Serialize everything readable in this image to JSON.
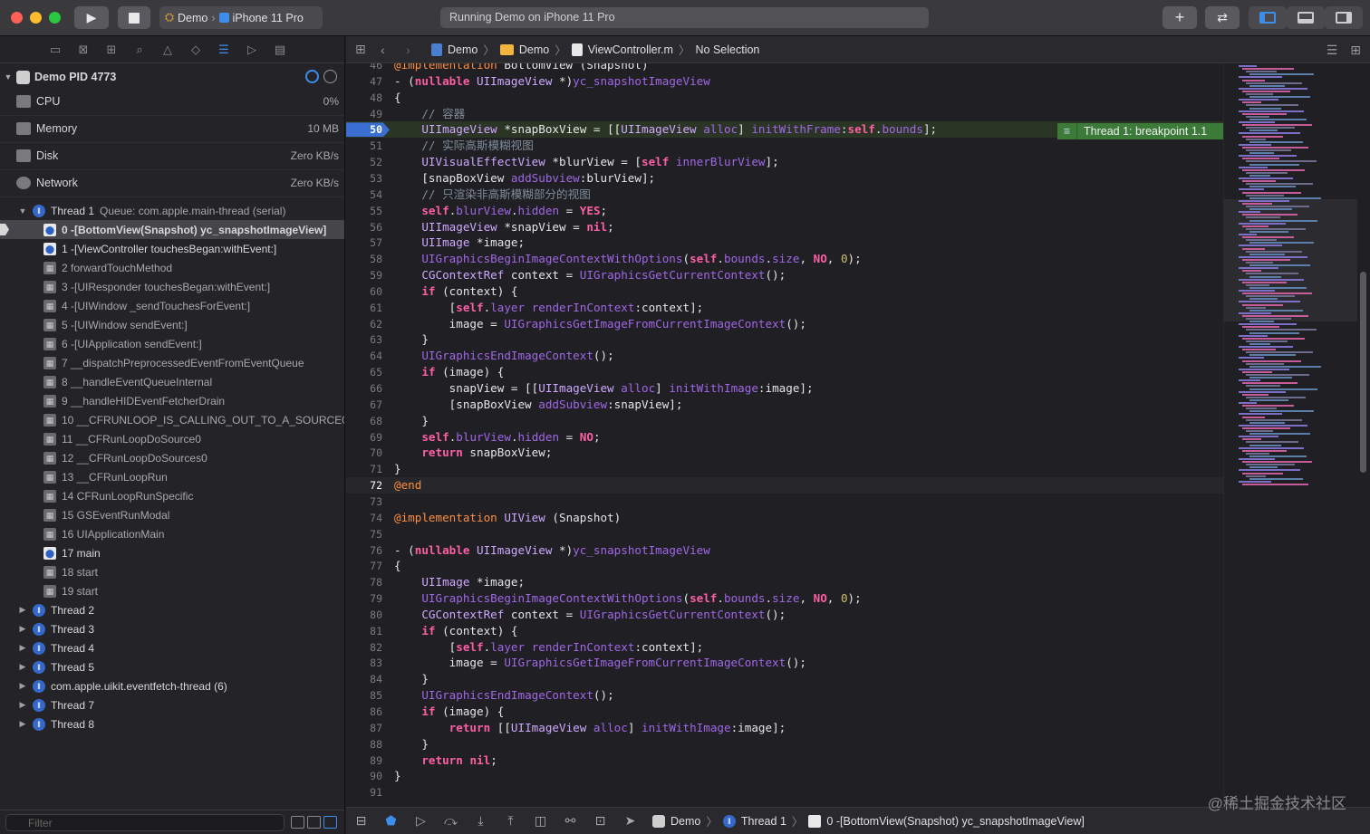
{
  "toolbar": {
    "scheme_target": "Demo",
    "scheme_device": "iPhone 11 Pro",
    "activity_status": "Running Demo on iPhone 11 Pro",
    "run_icon": "play-icon",
    "stop_icon": "stop-icon"
  },
  "navigator": {
    "process": "Demo PID 4773",
    "gauges": [
      {
        "label": "CPU",
        "value": "0%"
      },
      {
        "label": "Memory",
        "value": "10 MB"
      },
      {
        "label": "Disk",
        "value": "Zero KB/s"
      },
      {
        "label": "Network",
        "value": "Zero KB/s"
      }
    ],
    "thread1": "Thread 1",
    "thread1_queue": "Queue: com.apple.main-thread (serial)",
    "frames": [
      {
        "label": "0 -[BottomView(Snapshot) yc_snapshotImageView]",
        "kind": "user",
        "selected": true
      },
      {
        "label": "1 -[ViewController touchesBegan:withEvent:]",
        "kind": "user"
      },
      {
        "label": "2 forwardTouchMethod",
        "kind": "sys"
      },
      {
        "label": "3 -[UIResponder touchesBegan:withEvent:]",
        "kind": "sys"
      },
      {
        "label": "4 -[UIWindow _sendTouchesForEvent:]",
        "kind": "sys"
      },
      {
        "label": "5 -[UIWindow sendEvent:]",
        "kind": "sys"
      },
      {
        "label": "6 -[UIApplication sendEvent:]",
        "kind": "sys"
      },
      {
        "label": "7 __dispatchPreprocessedEventFromEventQueue",
        "kind": "sys"
      },
      {
        "label": "8 __handleEventQueueInternal",
        "kind": "sys"
      },
      {
        "label": "9 __handleHIDEventFetcherDrain",
        "kind": "sys"
      },
      {
        "label": "10 __CFRUNLOOP_IS_CALLING_OUT_TO_A_SOURCE0_...",
        "kind": "sys"
      },
      {
        "label": "11 __CFRunLoopDoSource0",
        "kind": "sys"
      },
      {
        "label": "12 __CFRunLoopDoSources0",
        "kind": "sys"
      },
      {
        "label": "13 __CFRunLoopRun",
        "kind": "sys"
      },
      {
        "label": "14 CFRunLoopRunSpecific",
        "kind": "sys"
      },
      {
        "label": "15 GSEventRunModal",
        "kind": "sys"
      },
      {
        "label": "16 UIApplicationMain",
        "kind": "sys"
      },
      {
        "label": "17 main",
        "kind": "user"
      },
      {
        "label": "18 start",
        "kind": "sys"
      },
      {
        "label": "19 start",
        "kind": "sys"
      }
    ],
    "other_threads": [
      "Thread 2",
      "Thread 3",
      "Thread 4",
      "Thread 5",
      "com.apple.uikit.eventfetch-thread (6)",
      "Thread 7",
      "Thread 8"
    ],
    "filter_placeholder": "Filter"
  },
  "jumpbar": {
    "crumbs": [
      "Demo",
      "Demo",
      "ViewController.m",
      "No Selection"
    ]
  },
  "editor": {
    "breakpoint_line": 50,
    "current_line": 72,
    "breakpoint_label": "Thread 1: breakpoint 1.1",
    "lines": [
      {
        "n": 46,
        "t": "@implementation BottomView (Snapshot)"
      },
      {
        "n": 47,
        "t": "- (nullable UIImageView *)yc_snapshotImageView"
      },
      {
        "n": 48,
        "t": "{"
      },
      {
        "n": 49,
        "t": "    // 容器"
      },
      {
        "n": 50,
        "t": "    UIImageView *snapBoxView = [[UIImageView alloc] initWithFrame:self.bounds];"
      },
      {
        "n": 51,
        "t": "    // 实际高斯模糊视图"
      },
      {
        "n": 52,
        "t": "    UIVisualEffectView *blurView = [self innerBlurView];"
      },
      {
        "n": 53,
        "t": "    [snapBoxView addSubview:blurView];"
      },
      {
        "n": 54,
        "t": "    // 只渲染非高斯模糊部分的视图"
      },
      {
        "n": 55,
        "t": "    self.blurView.hidden = YES;"
      },
      {
        "n": 56,
        "t": "    UIImageView *snapView = nil;"
      },
      {
        "n": 57,
        "t": "    UIImage *image;"
      },
      {
        "n": 58,
        "t": "    UIGraphicsBeginImageContextWithOptions(self.bounds.size, NO, 0);"
      },
      {
        "n": 59,
        "t": "    CGContextRef context = UIGraphicsGetCurrentContext();"
      },
      {
        "n": 60,
        "t": "    if (context) {"
      },
      {
        "n": 61,
        "t": "        [self.layer renderInContext:context];"
      },
      {
        "n": 62,
        "t": "        image = UIGraphicsGetImageFromCurrentImageContext();"
      },
      {
        "n": 63,
        "t": "    }"
      },
      {
        "n": 64,
        "t": "    UIGraphicsEndImageContext();"
      },
      {
        "n": 65,
        "t": "    if (image) {"
      },
      {
        "n": 66,
        "t": "        snapView = [[UIImageView alloc] initWithImage:image];"
      },
      {
        "n": 67,
        "t": "        [snapBoxView addSubview:snapView];"
      },
      {
        "n": 68,
        "t": "    }"
      },
      {
        "n": 69,
        "t": "    self.blurView.hidden = NO;"
      },
      {
        "n": 70,
        "t": "    return snapBoxView;"
      },
      {
        "n": 71,
        "t": "}"
      },
      {
        "n": 72,
        "t": "@end"
      },
      {
        "n": 73,
        "t": ""
      },
      {
        "n": 74,
        "t": "@implementation UIView (Snapshot)"
      },
      {
        "n": 75,
        "t": ""
      },
      {
        "n": 76,
        "t": "- (nullable UIImageView *)yc_snapshotImageView"
      },
      {
        "n": 77,
        "t": "{"
      },
      {
        "n": 78,
        "t": "    UIImage *image;"
      },
      {
        "n": 79,
        "t": "    UIGraphicsBeginImageContextWithOptions(self.bounds.size, NO, 0);"
      },
      {
        "n": 80,
        "t": "    CGContextRef context = UIGraphicsGetCurrentContext();"
      },
      {
        "n": 81,
        "t": "    if (context) {"
      },
      {
        "n": 82,
        "t": "        [self.layer renderInContext:context];"
      },
      {
        "n": 83,
        "t": "        image = UIGraphicsGetImageFromCurrentImageContext();"
      },
      {
        "n": 84,
        "t": "    }"
      },
      {
        "n": 85,
        "t": "    UIGraphicsEndImageContext();"
      },
      {
        "n": 86,
        "t": "    if (image) {"
      },
      {
        "n": 87,
        "t": "        return [[UIImageView alloc] initWithImage:image];"
      },
      {
        "n": 88,
        "t": "    }"
      },
      {
        "n": 89,
        "t": "    return nil;"
      },
      {
        "n": 90,
        "t": "}"
      },
      {
        "n": 91,
        "t": ""
      }
    ]
  },
  "debugbar": {
    "crumbs": [
      "Demo",
      "Thread 1",
      "0 -[BottomView(Snapshot) yc_snapshotImageView]"
    ]
  },
  "watermark": "@稀土掘金技术社区"
}
